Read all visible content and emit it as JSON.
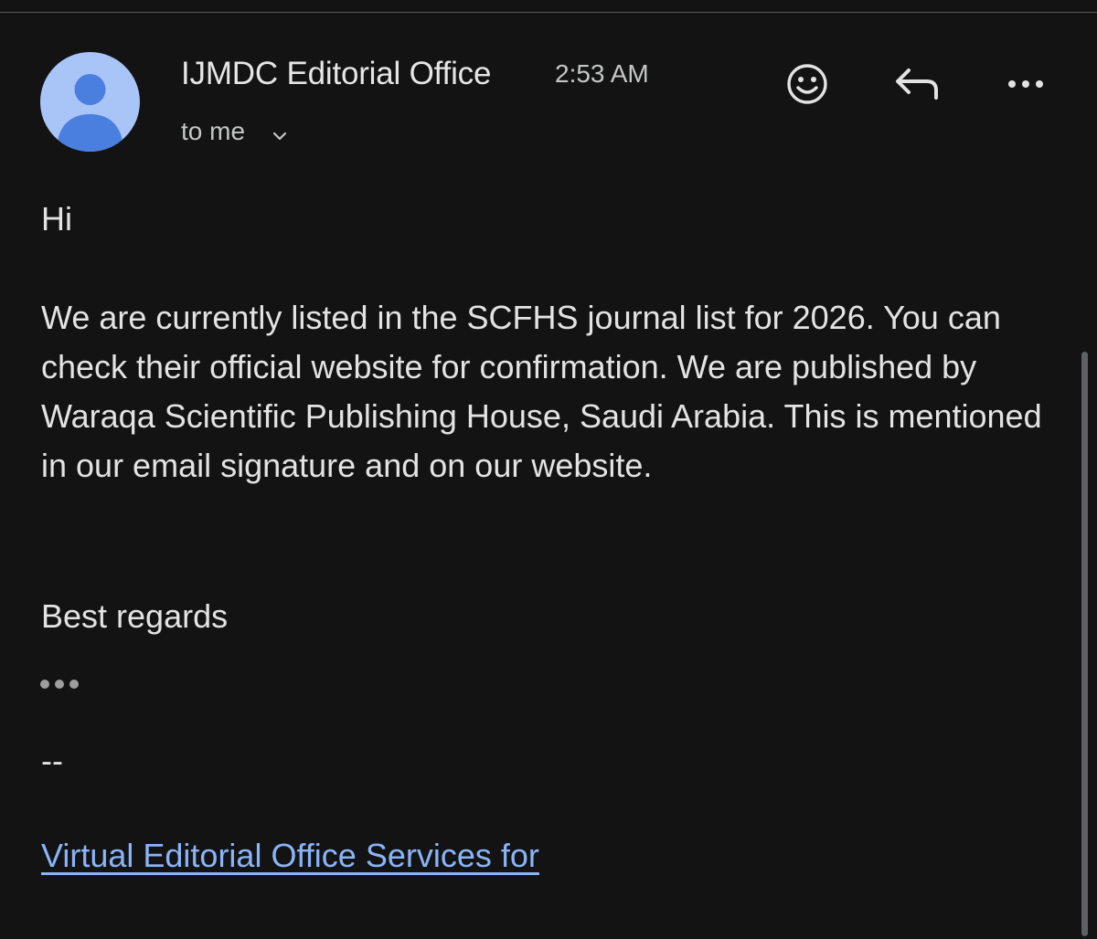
{
  "header": {
    "sender_name": "IJMDC Editorial Office",
    "time": "2:53 AM",
    "recipient": "to me"
  },
  "icons": {
    "avatar": "person-icon",
    "emoji": "smiley-face-icon",
    "reply": "reply-arrow-icon",
    "more": "more-horizontal-icon",
    "expand": "chevron-down-icon"
  },
  "colors": {
    "background": "#131314",
    "avatar_bg": "#a9c5f7",
    "avatar_fg": "#4a7fe0",
    "link": "#8ab4f8"
  },
  "email_body": {
    "greeting": "Hi",
    "paragraph": "We are currently listed in the SCFHS journal list for 2026. You can check their official website for confirmation. We are published by Waraqa Scientific Publishing House, Saudi Arabia. This is mentioned in our email signature and on our website.",
    "signoff": "Best regards",
    "signature_separator": "--",
    "signature_link": "Virtual Editorial Office Services for"
  }
}
